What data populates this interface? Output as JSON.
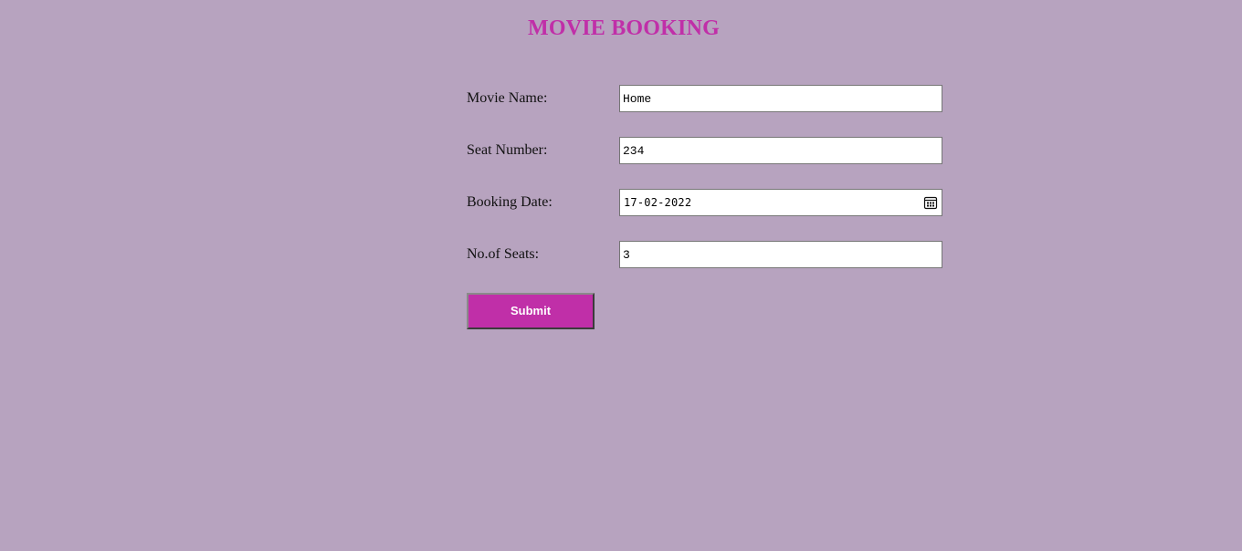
{
  "page": {
    "title": "MOVIE BOOKING",
    "background_color": "#b7a3bf",
    "accent_color": "#c02fa8"
  },
  "form": {
    "movie_name": {
      "label": "Movie Name:",
      "value": "Home"
    },
    "seat_number": {
      "label": "Seat Number:",
      "value": "234"
    },
    "booking_date": {
      "label": "Booking Date:",
      "value": "17-02-2022",
      "icon": "calendar-icon"
    },
    "seat_count": {
      "label": "No.of Seats:",
      "value": "3"
    },
    "submit_label": "Submit"
  }
}
